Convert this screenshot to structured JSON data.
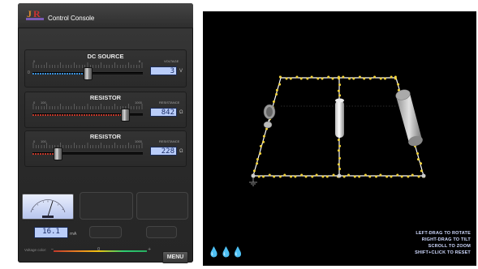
{
  "app": {
    "title": "Control Console",
    "logo_icon": "jr-logo-icon"
  },
  "dc_source": {
    "title": "DC SOURCE",
    "scale_min": "0",
    "scale_max": "6",
    "value_caption": "VOLTAGE",
    "value": "3",
    "unit": "V",
    "min_mark": "0",
    "fill_color": "#3a8fd8",
    "level": 0.5
  },
  "resistor_1": {
    "title": "RESISTOR",
    "scale_min": "0",
    "scale_mid": "100",
    "scale_max": "1000",
    "value_caption": "RESISTANCE",
    "value": "842",
    "unit": "Ω",
    "fill_color": "#c0392b",
    "level": 0.84
  },
  "resistor_2": {
    "title": "RESISTOR",
    "scale_min": "0",
    "scale_mid": "100",
    "scale_max": "1000",
    "value_caption": "RESISTANCE",
    "value": "228",
    "unit": "Ω",
    "fill_color": "#c0392b",
    "level": 0.23
  },
  "meter": {
    "reading": "16.1",
    "unit": "mA",
    "icon": "ammeter-gauge-icon"
  },
  "voltage_color": {
    "label": "Voltage color:",
    "left_mark": "–",
    "mid_mark": "0",
    "right_mark": "+"
  },
  "menu": {
    "label": "MENU"
  },
  "viewport": {
    "hints": [
      "LEFT-DRAG TO ROTATE",
      "RIGHT-DRAG TO TILT",
      "SCROLL TO ZOOM",
      "SHIFT+CLICK TO RESET"
    ],
    "drops_icon": "water-drops-icon",
    "electron_color": "#f2d23a",
    "wire_color": "#ffffff"
  }
}
